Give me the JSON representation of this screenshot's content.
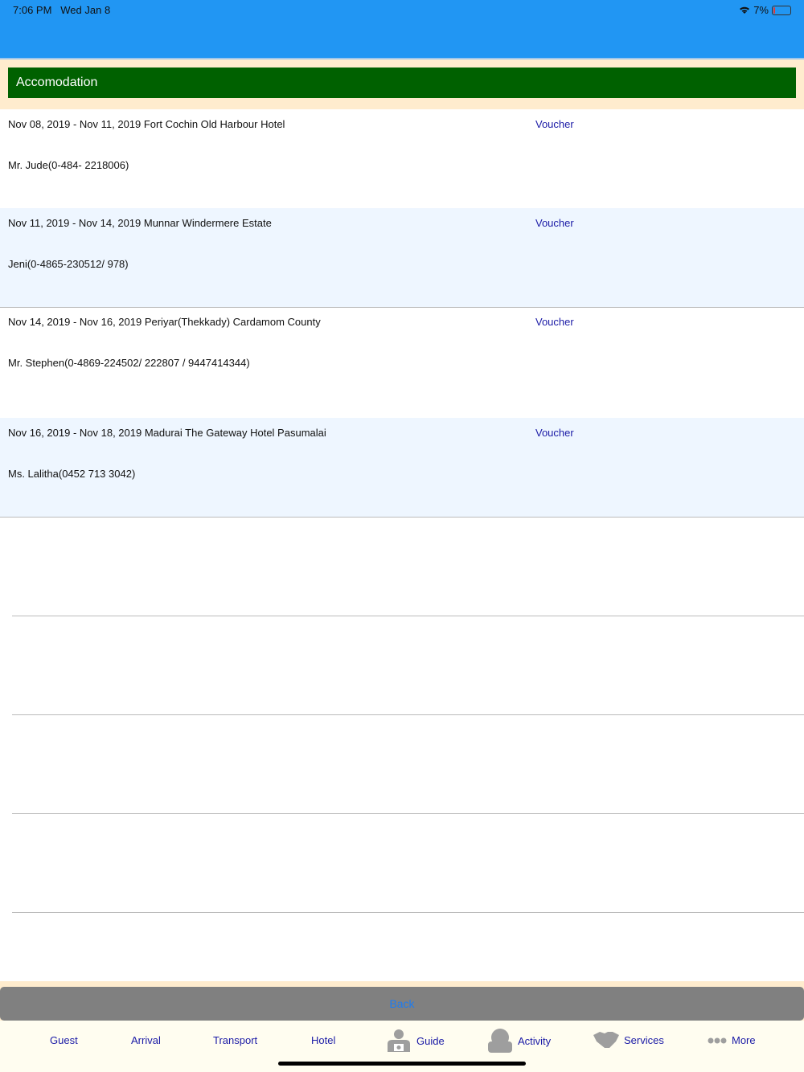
{
  "status": {
    "time": "7:06 PM",
    "date": "Wed Jan 8",
    "battery": "7%",
    "battery_level": 0.07
  },
  "header": {
    "title": "Accomodation"
  },
  "rows": [
    {
      "line1": "Nov 08, 2019 - Nov 11, 2019 Fort Cochin Old Harbour Hotel",
      "line2": "Mr. Jude(0-484- 2218006)",
      "voucher": "Voucher"
    },
    {
      "line1": "Nov 11, 2019 - Nov 14, 2019 Munnar Windermere Estate",
      "line2": "Jeni(0-4865-230512/ 978)",
      "voucher": "Voucher"
    },
    {
      "line1": "Nov 14, 2019 - Nov 16, 2019 Periyar(Thekkady) Cardamom County",
      "line2": "Mr. Stephen(0-4869-224502/ 222807 / 9447414344)",
      "voucher": "Voucher"
    },
    {
      "line1": "Nov 16, 2019 - Nov 18, 2019 Madurai The Gateway Hotel Pasumalai",
      "line2": "Ms. Lalitha(0452 713 3042)",
      "voucher": "Voucher"
    }
  ],
  "back_label": "Back",
  "tabs": [
    {
      "label": "Guest"
    },
    {
      "label": "Arrival"
    },
    {
      "label": "Transport"
    },
    {
      "label": "Hotel"
    },
    {
      "label": "Guide",
      "icon": "guide-camera-icon"
    },
    {
      "label": "Activity",
      "icon": "person-icon"
    },
    {
      "label": "Services",
      "icon": "handshake-icon"
    },
    {
      "label": "More",
      "icon": "more-dots-icon"
    }
  ]
}
